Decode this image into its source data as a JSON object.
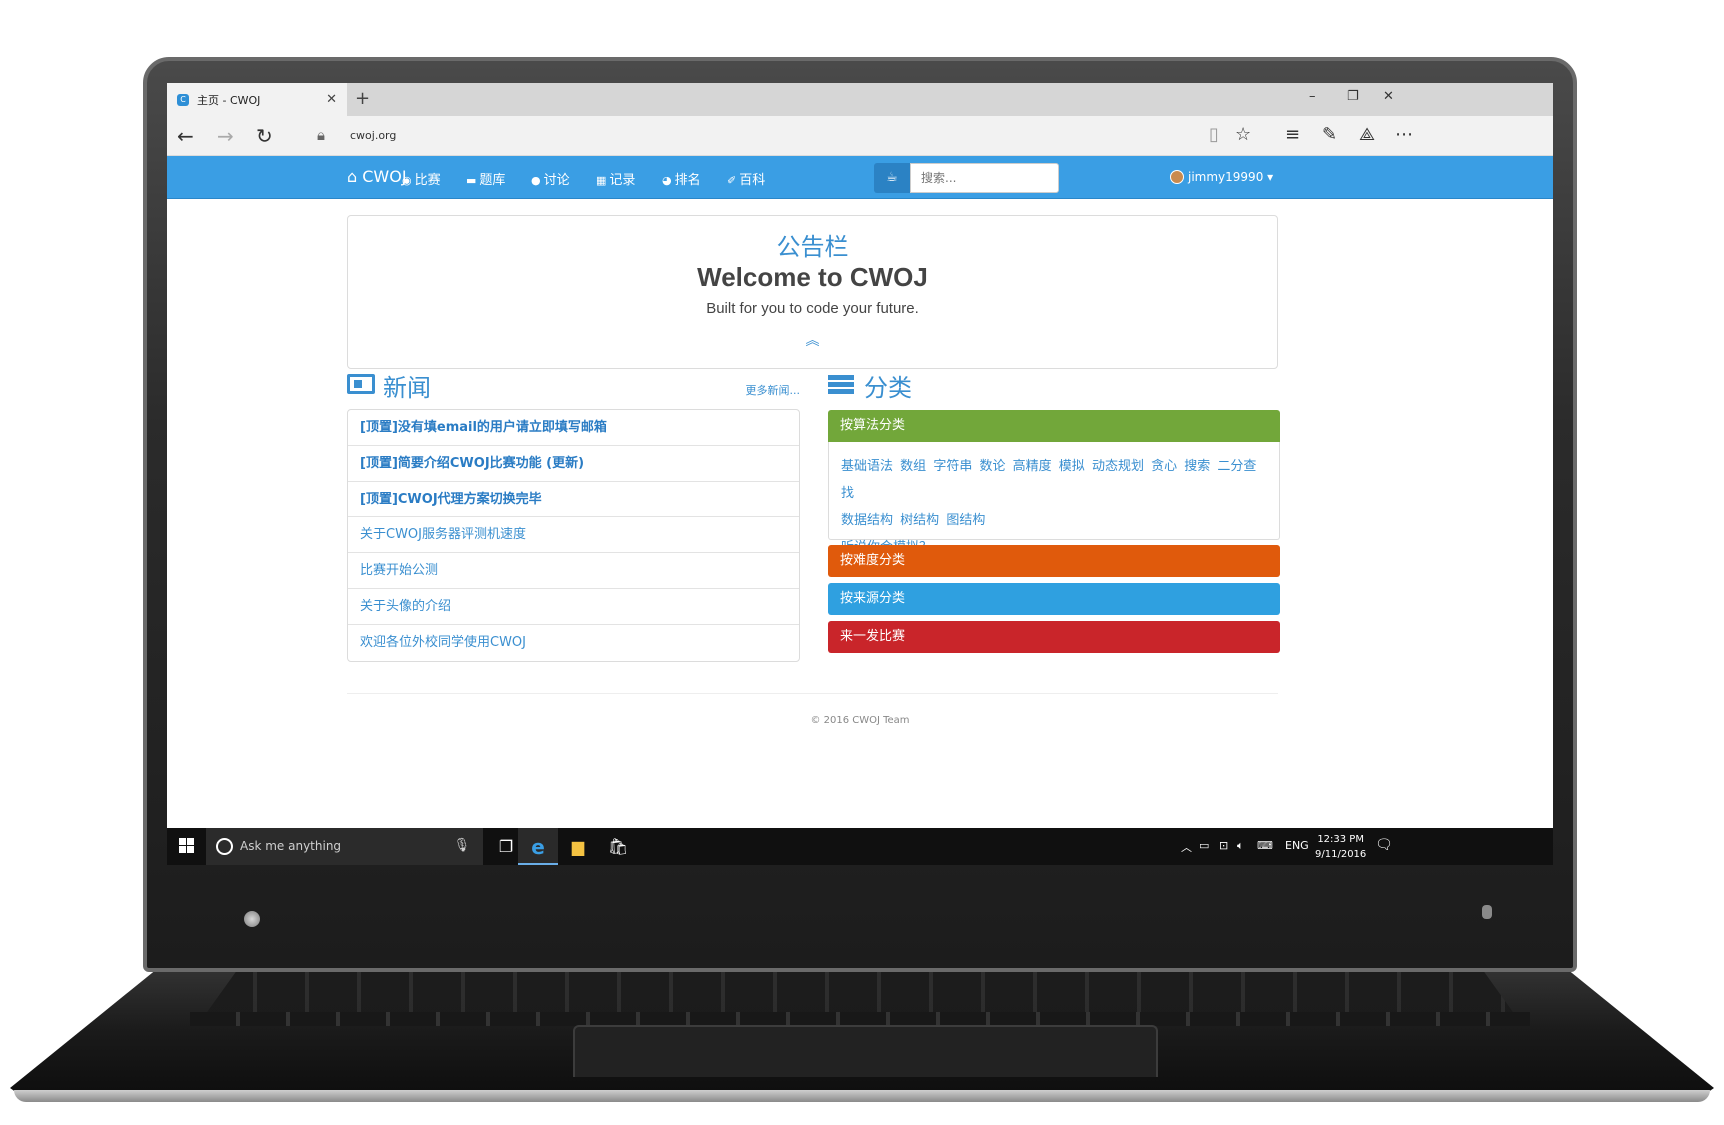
{
  "browser": {
    "tab_title": "主页 - CWOJ",
    "tab_favicon": "C",
    "new_tab_glyph": "+",
    "url": "cwoj.org",
    "window_controls": [
      "–",
      "❐",
      "✕"
    ]
  },
  "site_nav": {
    "brand": "CWOJ",
    "items": [
      {
        "icon": "trophy-icon",
        "label": "比赛"
      },
      {
        "icon": "book-icon",
        "label": "题库"
      },
      {
        "icon": "comment-icon",
        "label": "讨论"
      },
      {
        "icon": "record-icon",
        "label": "记录"
      },
      {
        "icon": "ranking-icon",
        "label": "排名"
      },
      {
        "icon": "wiki-icon",
        "label": "百科"
      }
    ],
    "search_placeholder": "搜索...",
    "username": "jimmy19990"
  },
  "announcement": {
    "title": "公告栏",
    "headline": "Welcome to CWOJ",
    "subtitle": "Built for you to code your future."
  },
  "news": {
    "title": "新闻",
    "more_link": "更多新闻...",
    "items": [
      {
        "text": "[顶置]没有填email的用户请立即填写邮箱",
        "pinned": true
      },
      {
        "text": "[顶置]简要介绍CWOJ比赛功能 (更新)",
        "pinned": true
      },
      {
        "text": "[顶置]CWOJ代理方案切换完毕",
        "pinned": true
      },
      {
        "text": "关于CWOJ服务器评测机速度",
        "pinned": false
      },
      {
        "text": "比赛开始公测",
        "pinned": false
      },
      {
        "text": "关于头像的介绍",
        "pinned": false
      },
      {
        "text": "欢迎各位外校同学使用CWOJ",
        "pinned": false
      }
    ]
  },
  "categories": {
    "title": "分类",
    "algorithm": {
      "label": "按算法分类",
      "color": "#72a73a",
      "tags_row1": [
        "基础语法",
        "数组",
        "字符串",
        "数论",
        "高精度",
        "模拟",
        "动态规划",
        "贪心",
        "搜索",
        "二分查找"
      ],
      "tags_row2": [
        "数据结构",
        "树结构",
        "图结构"
      ],
      "tags_row3": [
        "听说你会模拟？"
      ]
    },
    "difficulty": {
      "label": "按难度分类",
      "color": "#e05a0c"
    },
    "source": {
      "label": "按来源分类",
      "color": "#2fa0e0"
    },
    "contest": {
      "label": "来一发比赛",
      "color": "#c9252a"
    }
  },
  "footer": {
    "text": "© 2016 CWOJ Team"
  },
  "taskbar": {
    "search_placeholder": "Ask me anything",
    "language": "ENG",
    "time": "12:33 PM",
    "date": "9/11/2016"
  }
}
